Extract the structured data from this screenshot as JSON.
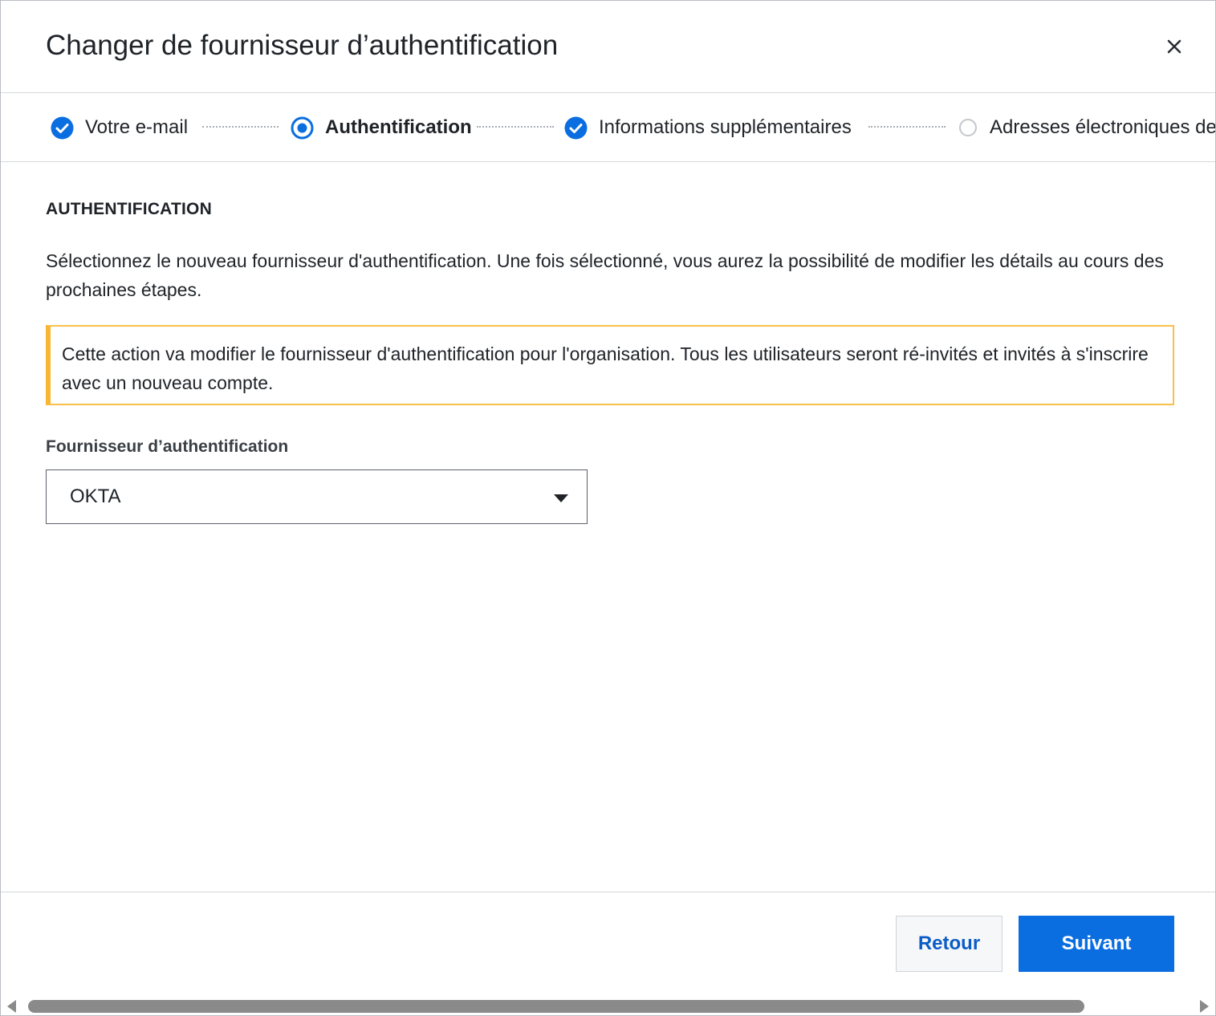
{
  "dialog": {
    "title": "Changer de fournisseur d’authentification",
    "close_icon": "close-icon"
  },
  "stepper": {
    "steps": [
      {
        "label": "Votre e-mail",
        "status": "completed",
        "icon": "check-circle-icon"
      },
      {
        "label": "Authentification",
        "status": "current",
        "icon": "radio-selected-icon"
      },
      {
        "label": "Informations supplémentaires",
        "status": "completed",
        "icon": "check-circle-icon"
      },
      {
        "label": "Adresses électroniques de",
        "status": "pending",
        "icon": "empty-circle-icon"
      }
    ]
  },
  "content": {
    "section_title": "AUTHENTIFICATION",
    "intro": "Sélectionnez le nouveau fournisseur d'authentification. Une fois sélectionné, vous aurez la possibilité de modifier les détails au cours des prochaines étapes.",
    "warning": "Cette action va modifier le fournisseur d'authentification pour l'organisation. Tous les utilisateurs seront ré-invités et invités à s'inscrire avec un nouveau compte.",
    "provider_label": "Fournisseur d’authentification",
    "provider_value": "OKTA"
  },
  "footer": {
    "back_label": "Retour",
    "next_label": "Suivant"
  },
  "colors": {
    "accent": "#0a6ee0",
    "warning_border": "#f7b731",
    "back_text": "#0b5cc7"
  }
}
